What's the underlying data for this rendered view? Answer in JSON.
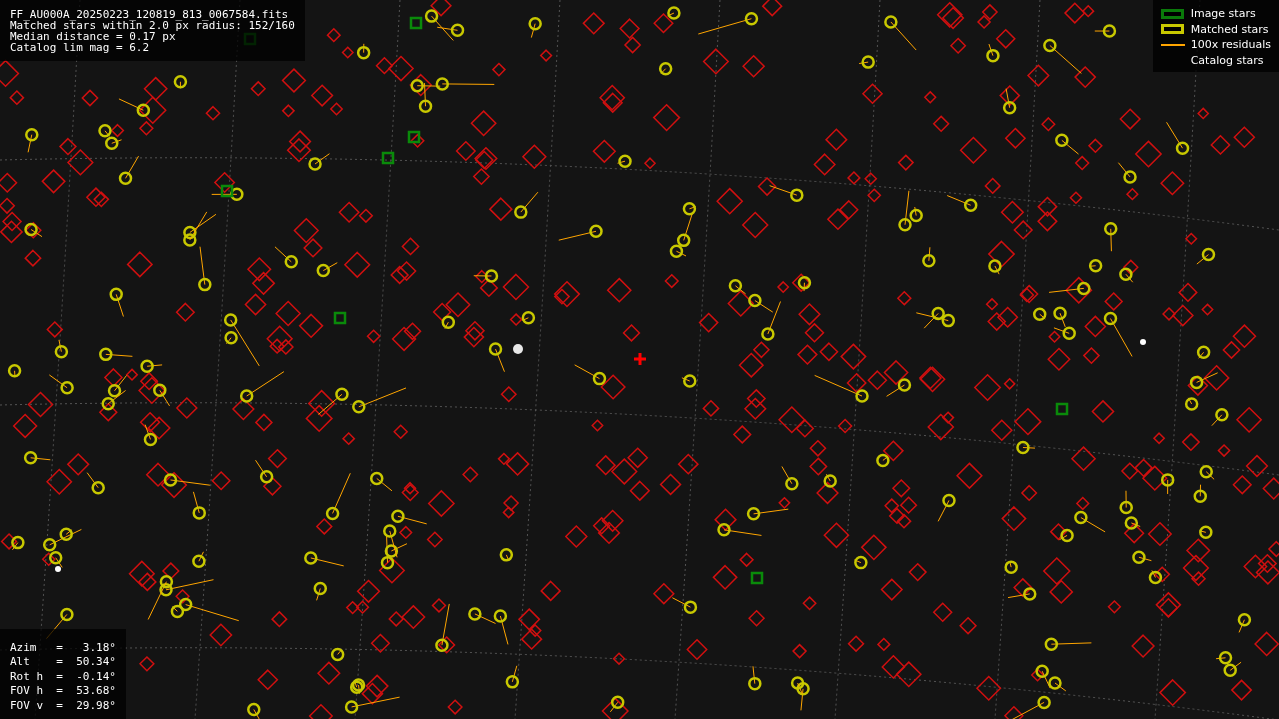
{
  "info": {
    "lines": [
      "FF_AU000A_20250223_120819_813_0067584.fits",
      "Matched stars within 2.0 px radius: 152/160",
      "Median distance = 0.17 px",
      "Catalog lim mag = 6.2"
    ]
  },
  "legend": [
    {
      "kind": "box",
      "color": "#0a7a0a",
      "label": "Image stars"
    },
    {
      "kind": "box",
      "color": "#c8c800",
      "label": "Matched stars"
    },
    {
      "kind": "line",
      "color": "#ffa500",
      "label": "100x residuals"
    },
    {
      "kind": "none",
      "label": "Catalog stars"
    }
  ],
  "pointing": {
    "lines": [
      "Azim   =   3.18°",
      "Alt    =  50.34°",
      "Rot h  =  -0.14°",
      "FOV h  =  53.68°",
      "FOV v  =  29.98°"
    ]
  }
}
